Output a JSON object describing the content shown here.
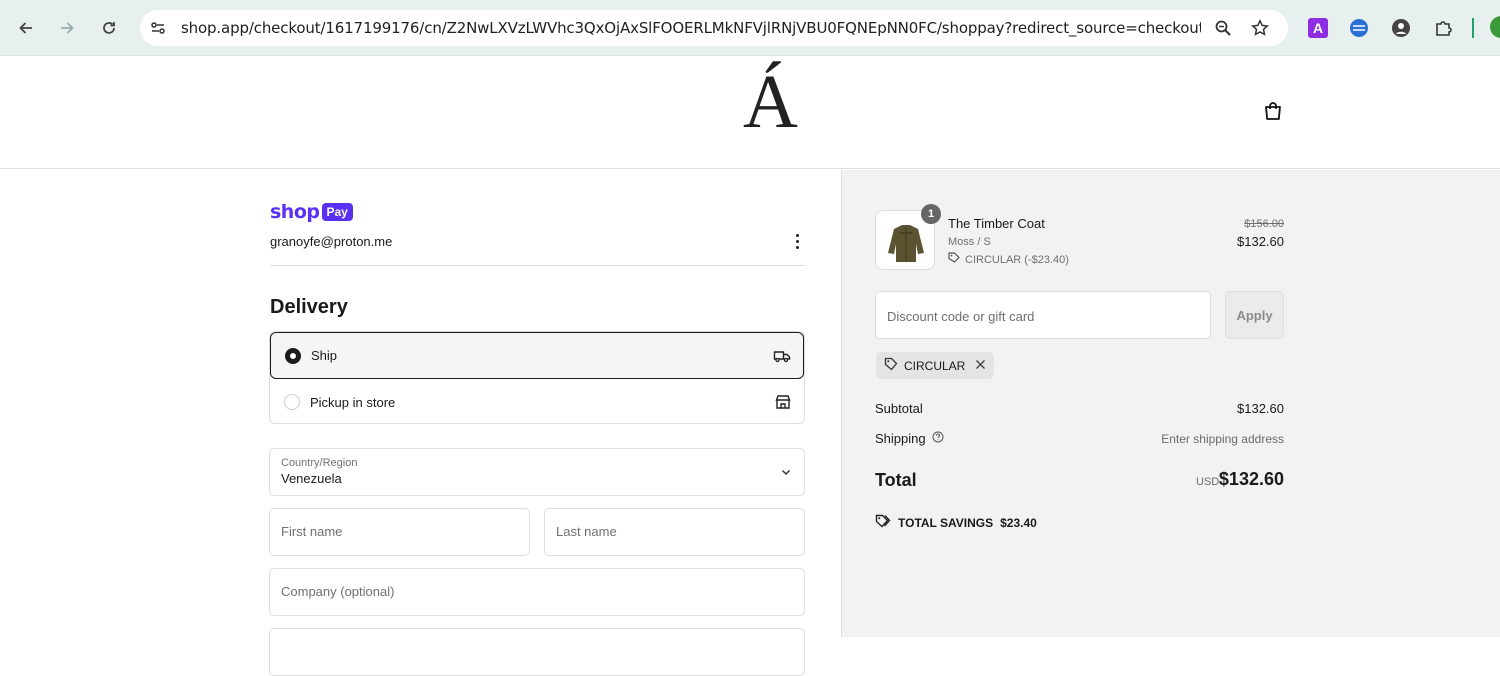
{
  "browser": {
    "url": "shop.app/checkout/1617199176/cn/Z2NwLXVzLWVhc3QxOjAxSlFOOERLMkNFVjlRNjVBU0FQNEpNN0FC/shoppay?redirect_source=checkout_...",
    "ext_letter": "A"
  },
  "store": {
    "logo": "Á"
  },
  "account": {
    "shoppay_word": "shop",
    "shoppay_pill": "Pay",
    "email": "granoyfe@proton.me"
  },
  "delivery": {
    "title": "Delivery",
    "options": [
      {
        "label": "Ship",
        "selected": true
      },
      {
        "label": "Pickup in store",
        "selected": false
      }
    ]
  },
  "form": {
    "country_label": "Country/Region",
    "country_value": "Venezuela",
    "first_name_ph": "First name",
    "last_name_ph": "Last name",
    "company_ph": "Company (optional)"
  },
  "summary": {
    "item": {
      "qty": "1",
      "name": "The Timber Coat",
      "variant": "Moss / S",
      "discount": "CIRCULAR (-$23.40)",
      "price_old": "$156.00",
      "price_new": "$132.60"
    },
    "discount_ph": "Discount code or gift card",
    "apply": "Apply",
    "code_chip": "CIRCULAR",
    "subtotal_label": "Subtotal",
    "subtotal_value": "$132.60",
    "shipping_label": "Shipping",
    "shipping_value": "Enter shipping address",
    "total_label": "Total",
    "total_currency": "USD",
    "total_value": "$132.60",
    "savings_label": "TOTAL SAVINGS",
    "savings_value": "$23.40"
  },
  "colors": {
    "shoppay": "#5a31f4",
    "summary_bg": "#f2f2f2"
  }
}
